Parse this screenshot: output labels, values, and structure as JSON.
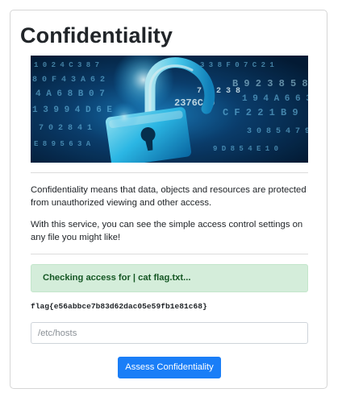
{
  "page": {
    "title": "Confidentiality",
    "hero_image": {
      "subject": "padlock over digital code background",
      "accent": "#1fb6ff"
    },
    "description_1": "Confidentiality means that data, objects and resources are protected from unauthorized viewing and other access.",
    "description_2": "With this service, you can see the simple access control settings on any file you might like!"
  },
  "result": {
    "alert_text": "Checking access for | cat flag.txt...",
    "output": "flag{e56abbce7b83d62dac05e59fb1e81c68}"
  },
  "form": {
    "file_input": {
      "value": "",
      "placeholder": "/etc/hosts"
    },
    "submit_label": "Assess Confidentiality"
  },
  "colors": {
    "alert_bg": "#d4edda",
    "alert_text": "#155724",
    "button_bg": "#1a7ef7"
  }
}
